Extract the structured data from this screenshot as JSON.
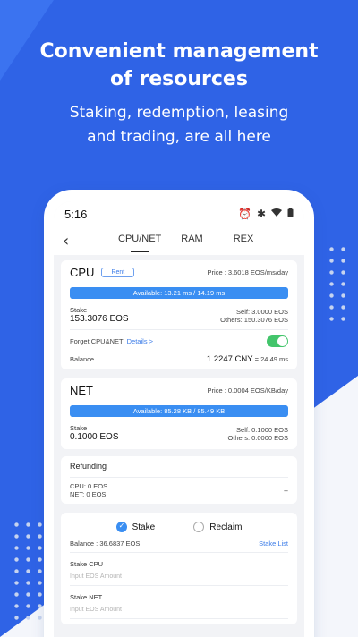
{
  "promo": {
    "headline_1": "Convenient management",
    "headline_2": "of resources",
    "sub_1": "Staking, redemption, leasing",
    "sub_2": "and trading, are all here"
  },
  "status": {
    "time": "5:16"
  },
  "nav": {
    "tabs": [
      "CPU/NET",
      "RAM",
      "REX"
    ],
    "active": 0
  },
  "cpu": {
    "title": "CPU",
    "rent_label": "Rent",
    "price": "Price : 3.6018 EOS/ms/day",
    "available": "Available: 13.21 ms / 14.19 ms",
    "available_fraction": 0.93,
    "stake_label": "Stake",
    "stake_value": "153.3076 EOS",
    "self": "Self: 3.0000 EOS",
    "others": "Others: 150.3076 EOS",
    "forget_label": "Forget CPU&NET",
    "details_link": "Details >",
    "balance_label": "Balance",
    "balance_value": "1.2247 CNY",
    "balance_eq": " = 24.49 ms"
  },
  "net": {
    "title": "NET",
    "price": "Price : 0.0004 EOS/KB/day",
    "available": "Available: 85.28 KB / 85.49 KB",
    "available_fraction": 0.99,
    "stake_label": "Stake",
    "stake_value": "0.1000 EOS",
    "self": "Self: 0.1000 EOS",
    "others": "Others: 0.0000 EOS"
  },
  "refunding": {
    "title": "Refunding",
    "cpu": "CPU: 0 EOS",
    "net": "NET: 0 EOS",
    "value": "--"
  },
  "stake_form": {
    "stake_option": "Stake",
    "reclaim_option": "Reclaim",
    "balance": "Balance : 36.6837 EOS",
    "stake_list_link": "Stake List",
    "stake_cpu_label": "Stake CPU",
    "stake_cpu_placeholder": "Input EOS Amount",
    "stake_net_label": "Stake NET",
    "stake_net_placeholder": "Input EOS Amount"
  }
}
